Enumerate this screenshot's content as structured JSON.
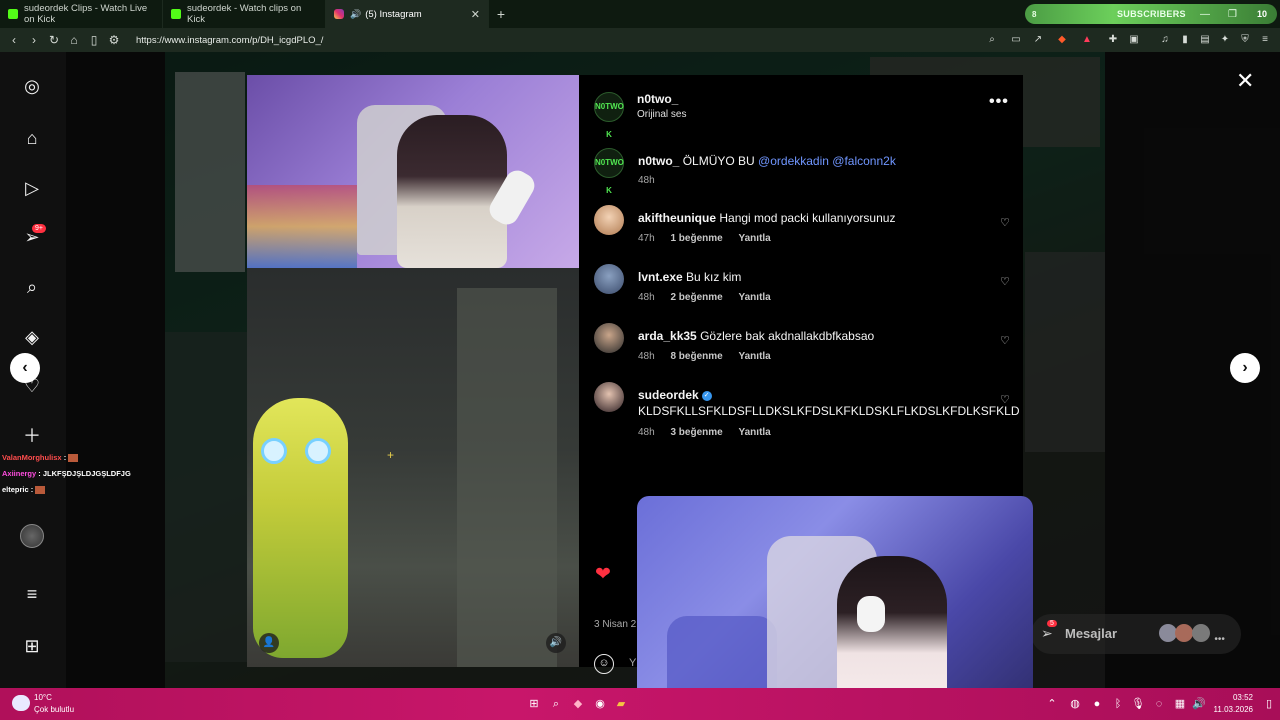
{
  "browser": {
    "tabs": [
      {
        "title": "sudeordek Clips - Watch Live on Kick",
        "icon": "kick-icon"
      },
      {
        "title": "sudeordek - Watch clips on Kick",
        "icon": "kick-icon"
      },
      {
        "title": "(5) Instagram",
        "icon": "instagram-icon",
        "active": true
      }
    ],
    "url": "https://www.instagram.com/p/DH_icgdPLO_/",
    "subs_widget": {
      "left_value": "8",
      "label": "SUBSCRIBERS",
      "count": "10"
    }
  },
  "sidebar": {
    "notifications_badge": "9+"
  },
  "stream_chat": [
    {
      "user": "ValanMorghulisx",
      "sep": ":",
      "text": ""
    },
    {
      "user": "Axiinergy",
      "sep": ":",
      "text": "JLKFŞDJŞLDJGŞLDFJG"
    },
    {
      "user": "eltepric",
      "sep": ":",
      "text": ""
    }
  ],
  "post": {
    "author": "n0two_",
    "audio": "Orijinal ses",
    "avatar_text": "N0TWO K",
    "caption": {
      "user": "n0two_",
      "text": "ÖLMÜYO BU",
      "mentions": "@ordekkadin @falconn2k",
      "time": "48h"
    },
    "comments": [
      {
        "user": "akiftheunique",
        "text": "Hangi mod packi kullanıyorsunuz",
        "time": "47h",
        "likes": "1 beğenme",
        "reply": "Yanıtla",
        "verified": false
      },
      {
        "user": "lvnt.exe",
        "text": "Bu kız kim",
        "time": "48h",
        "likes": "2 beğenme",
        "reply": "Yanıtla",
        "verified": false
      },
      {
        "user": "arda_kk35",
        "text": "Gözlere bak akdnallakdbfkabsao",
        "time": "48h",
        "likes": "8 beğenme",
        "reply": "Yanıtla",
        "verified": false
      },
      {
        "user": "sudeordek",
        "text": "KLDSFKLLSFKLDSFLLDKSLKFDSLKFKLDSKLFLKDSLKFDLKSFKLD",
        "time": "48h",
        "likes": "3 beğenme",
        "reply": "Yanıtla",
        "verified": true
      }
    ],
    "date": "3 Nisan 2",
    "comment_placeholder": "Y"
  },
  "messages": {
    "label": "Mesajlar",
    "badge": "5"
  },
  "taskbar": {
    "weather_temp": "10°C",
    "weather_desc": "Çok bulutlu",
    "time": "03:52",
    "date": "11.03.2026"
  },
  "colors": {
    "accent_like": "#ff3040",
    "mention": "#7096ff",
    "verified": "#3797f0",
    "taskbar": "#c8166a"
  }
}
